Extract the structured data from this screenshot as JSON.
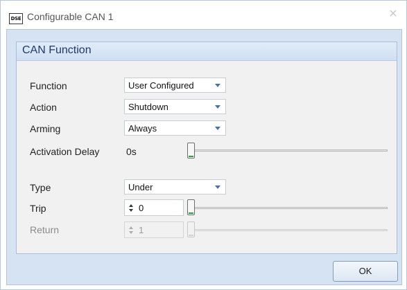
{
  "window": {
    "icon_text": "DSE",
    "title": "Configurable CAN 1",
    "close_glyph": "✕"
  },
  "group": {
    "title": "CAN Function"
  },
  "fields": {
    "function": {
      "label": "Function",
      "value": "User Configured"
    },
    "action": {
      "label": "Action",
      "value": "Shutdown"
    },
    "arming": {
      "label": "Arming",
      "value": "Always"
    },
    "activation_delay": {
      "label": "Activation Delay",
      "value": "0s",
      "slider_fraction": 0
    },
    "type": {
      "label": "Type",
      "value": "Under"
    },
    "trip": {
      "label": "Trip",
      "value": "0",
      "slider_fraction": 0
    },
    "return": {
      "label": "Return",
      "value": "1",
      "enabled": false,
      "slider_fraction": 0
    }
  },
  "buttons": {
    "ok_label": "OK"
  },
  "colors": {
    "accent_green": "#2ea043",
    "dropdown_arrow": "#4a6fb0",
    "group_header": "#cfdff1",
    "client_background": "#d6e3f3"
  },
  "icons": {
    "app": "dse-logo-icon",
    "close": "close-icon",
    "dropdown": "chevron-down-icon",
    "spin": "spin-arrows-icon"
  }
}
